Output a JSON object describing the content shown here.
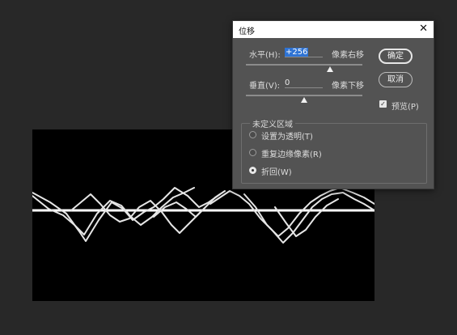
{
  "dialog": {
    "title": "位移",
    "close_glyph": "✕",
    "horizontal": {
      "label": "水平(H):",
      "value": "+256",
      "unit": "像素右移",
      "slider_fraction": 0.72
    },
    "vertical": {
      "label": "垂直(V):",
      "value": "0",
      "unit": "像素下移",
      "slider_fraction": 0.5
    },
    "ok_label": "确定",
    "cancel_label": "取消",
    "preview": {
      "label": "预览(P)",
      "checked": true,
      "check_glyph": "✓"
    },
    "undefined_area": {
      "label": "未定义区域",
      "options": [
        {
          "label": "设置为透明(T)",
          "selected": false
        },
        {
          "label": "重复边缘像素(R)",
          "selected": false
        },
        {
          "label": "折回(W)",
          "selected": true
        }
      ]
    }
  }
}
